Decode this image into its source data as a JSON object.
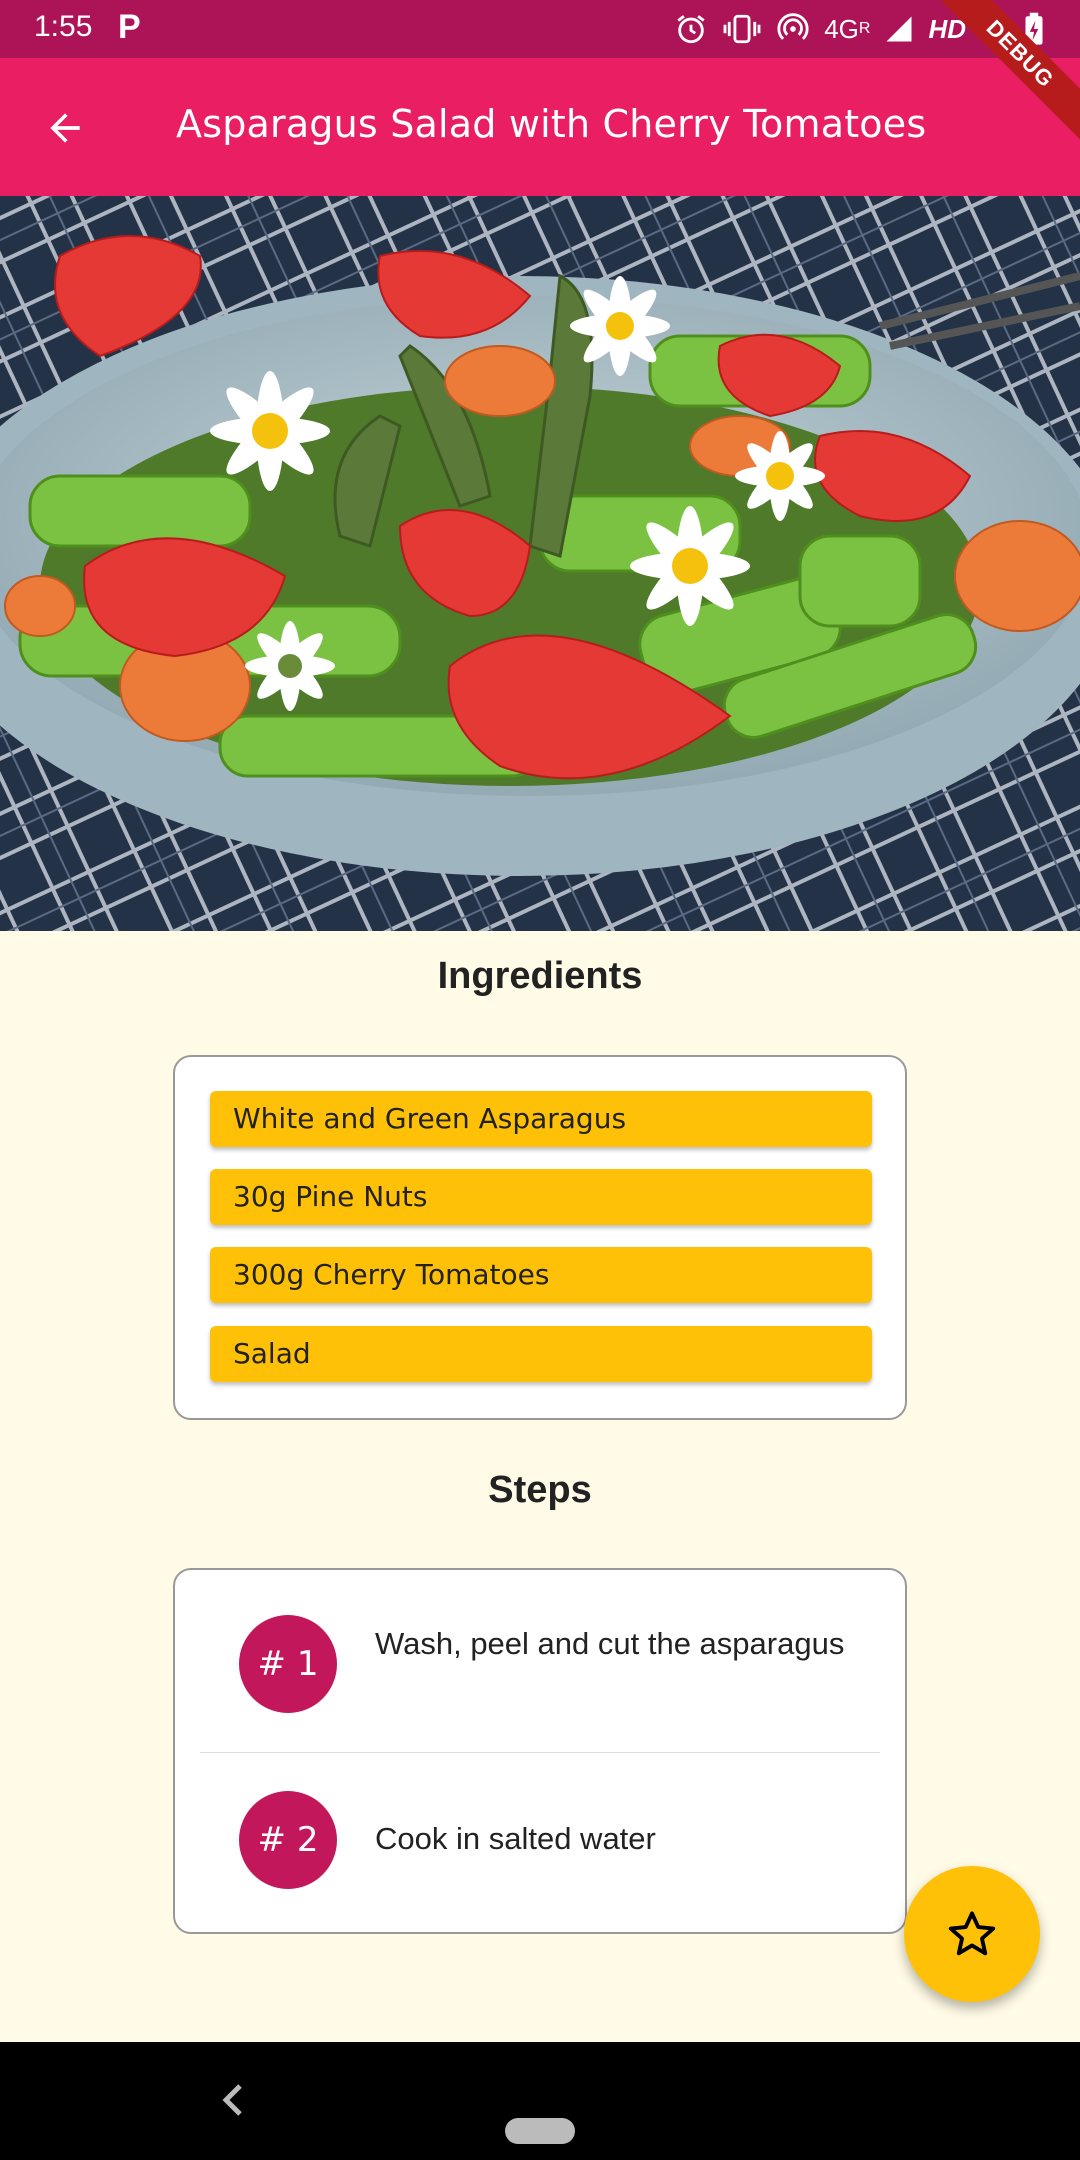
{
  "status_bar": {
    "time": "1:55",
    "app_indicator": "P",
    "network": "4G",
    "network_sup": "R",
    "hd": "HD",
    "icons": [
      "alarm-icon",
      "vibrate-icon",
      "hotspot-icon",
      "signal-icon",
      "signal-r-icon",
      "battery-charging-icon"
    ]
  },
  "debug_banner": "DEBUG",
  "app_bar": {
    "back_icon": "arrow-back-icon",
    "title": "Asparagus Salad with Cherry Tomatoes"
  },
  "ingredients": {
    "heading": "Ingredients",
    "items": [
      "White and Green Asparagus",
      "30g Pine Nuts",
      "300g Cherry Tomatoes",
      "Salad"
    ]
  },
  "steps": {
    "heading": "Steps",
    "items": [
      {
        "badge": "# 1",
        "text": "Wash, peel and cut the asparagus"
      },
      {
        "badge": "# 2",
        "text": "Cook in salted water"
      }
    ]
  },
  "fab": {
    "icon": "star-outline-icon"
  },
  "colors": {
    "status_bar": "#ad1457",
    "app_bar": "#e91e63",
    "background": "#fffbe6",
    "ingredient_chip": "#ffc107",
    "step_badge": "#c2185b",
    "fab": "#ffc107"
  }
}
